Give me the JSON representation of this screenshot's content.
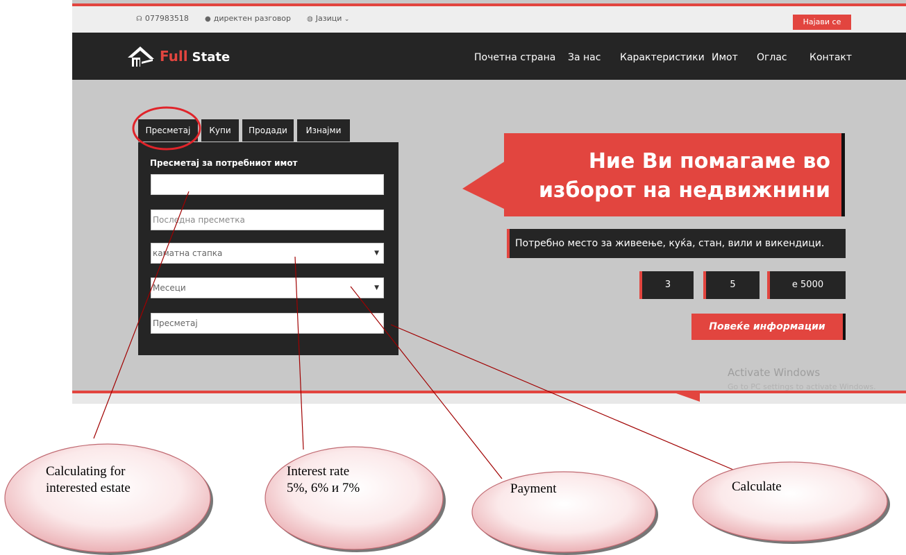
{
  "topbar": {
    "phone": "077983518",
    "chat": "директен разговор",
    "languages": "Јазици",
    "login": "Најави се"
  },
  "brand": {
    "full": "Full",
    "state": "State"
  },
  "nav": {
    "items": [
      "Почетна страна",
      "За нас",
      "Карактеристики",
      "Имот",
      "Оглас",
      "Контакт"
    ]
  },
  "tabs": [
    "Пресметај",
    "Купи",
    "Продади",
    "Изнајми"
  ],
  "form": {
    "title": "Пресметај за потребниот имот",
    "field1_value": "",
    "field2_placeholder": "Последна пресметка",
    "interest_select": "каматна стапка",
    "months_select": "Месеци",
    "calculate": "Пресметај"
  },
  "hero": {
    "line1": "Ние Ви помагаме во",
    "line2": "изборот на недвижнини",
    "subtitle": "Потребно место за живеење, куќа, стан, вили и викендици.",
    "stats": [
      "3",
      "5",
      "e 5000"
    ],
    "more_button": "Повеќе информации"
  },
  "watermark": {
    "line1": "Activate Windows",
    "line2": "Go to PC settings to activate Windows."
  },
  "annotations": {
    "bubble1_line1": "Calculating for",
    "bubble1_line2": "interested estate",
    "bubble2_line1": "Interest rate",
    "bubble2_line2": "5%, 6% и 7%",
    "bubble3": "Payment",
    "bubble4": "Calculate"
  },
  "colors": {
    "accent": "#e2453f",
    "dark": "#252525",
    "hero_bg": "#c8c8c8"
  },
  "icons": [
    "headset-icon",
    "chat-bubble-icon",
    "globe-icon",
    "house-logo-icon",
    "chevron-down-icon"
  ]
}
